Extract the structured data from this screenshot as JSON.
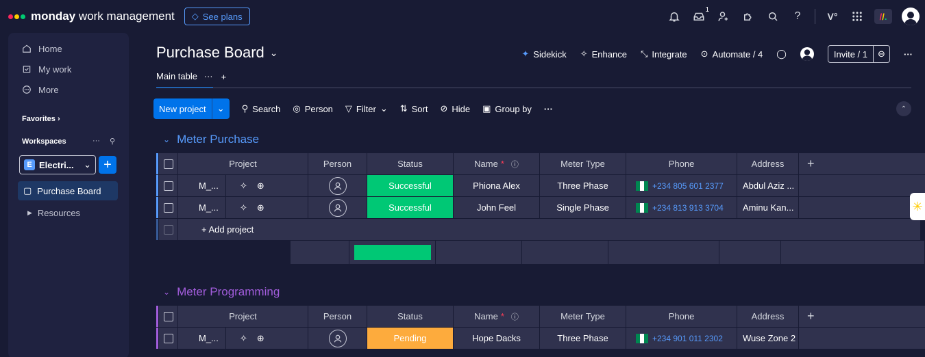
{
  "app": {
    "brand_bold": "monday",
    "brand_rest": " work management",
    "see_plans": "See plans",
    "notification_badge": "1"
  },
  "sidebar": {
    "items": [
      {
        "label": "Home",
        "icon": "home-icon"
      },
      {
        "label": "My work",
        "icon": "calendar-check-icon"
      },
      {
        "label": "More",
        "icon": "more-circle-icon"
      }
    ],
    "favorites": "Favorites",
    "workspaces": "Workspaces",
    "workspace_letter": "E",
    "workspace_name": "Electri...",
    "board_item": "Purchase Board",
    "resources": "Resources"
  },
  "board": {
    "title": "Purchase Board",
    "actions": {
      "sidekick": "Sidekick",
      "enhance": "Enhance",
      "integrate": "Integrate",
      "automate": "Automate / 4",
      "invite": "Invite / 1"
    },
    "tabs": {
      "main": "Main table"
    },
    "toolbar": {
      "new_item": "New project",
      "search": "Search",
      "person": "Person",
      "filter": "Filter",
      "sort": "Sort",
      "hide": "Hide",
      "group_by": "Group by"
    }
  },
  "columns": {
    "project": "Project",
    "person": "Person",
    "status": "Status",
    "name": "Name",
    "name_required": "*",
    "meter_type": "Meter Type",
    "phone": "Phone",
    "address": "Address",
    "add_column": "+"
  },
  "groups": [
    {
      "title": "Meter Purchase",
      "color": "#579bfc",
      "rows": [
        {
          "project": "M_...",
          "status": "Successful",
          "name": "Phiona Alex",
          "meter": "Three Phase",
          "phone": "+234 805 601 2377",
          "address": "Abdul Aziz ..."
        },
        {
          "project": "M_...",
          "status": "Successful",
          "name": "John Feel",
          "meter": "Single Phase",
          "phone": "+234 813 913 3704",
          "address": "Aminu Kan..."
        }
      ],
      "add_label": "+ Add project",
      "summary_status": "#00c875"
    },
    {
      "title": "Meter Programming",
      "color": "#a25ddc",
      "rows": [
        {
          "project": "M_...",
          "status": "Pending",
          "name": "Hope Dacks",
          "meter": "Three Phase",
          "phone": "+234 901 011 2302",
          "address": "Wuse Zone 2"
        }
      ]
    }
  ],
  "colors": {
    "status_successful": "#00c875",
    "status_pending": "#fdab3d",
    "primary": "#0073ea"
  }
}
